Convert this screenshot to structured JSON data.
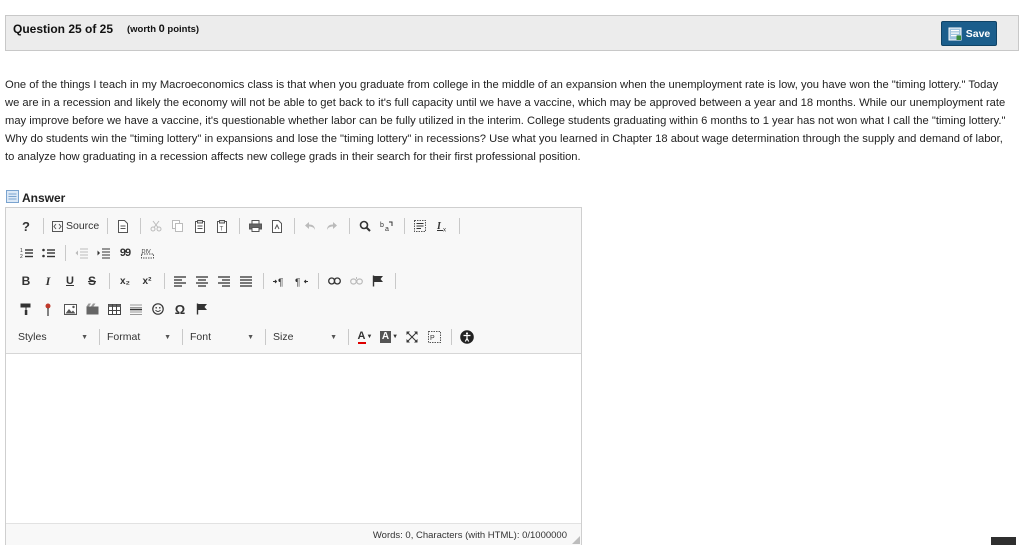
{
  "header": {
    "question_label": "Question 25 of 25",
    "worth_prefix": "(worth ",
    "worth_value": "0",
    "worth_suffix": " points)",
    "save_label": "Save"
  },
  "question": {
    "text": "One of the things I teach in my Macroeconomics class is that when you graduate from college in the middle of an expansion when the unemployment rate is low, you have won the \"timing lottery.\"  Today we are in a recession and likely the economy will not be able to get back to it's full capacity until we have a vaccine, which may be approved between a year and 18 months. While our unemployment rate may improve before we have a vaccine, it's questionable whether labor can be fully utilized in the interim.  College students graduating within 6 months to 1 year has not won what I call the \"timing lottery.\"  Why do students win the \"timing lottery\" in expansions and lose the \"timing lottery\" in recessions?  Use what you learned in Chapter 18 about wage determination through the supply and demand of labor, to analyze how graduating in a recession affects new college grads in their search for their first professional position."
  },
  "answer": {
    "label": "Answer"
  },
  "editor": {
    "toolbar": {
      "help": "?",
      "source": "Source",
      "bold": "B",
      "italic": "I",
      "underline": "U",
      "strike": "S",
      "subscript": "x₂",
      "superscript": "x²",
      "blockquote": "99",
      "omega": "Ω",
      "styles": "Styles",
      "format": "Format",
      "font": "Font",
      "size": "Size",
      "text_color": "A",
      "bg_color": "A"
    },
    "status": {
      "word_count": "Words: 0, Characters (with HTML): 0/1000000"
    }
  },
  "colors": {
    "save_button": "#1b5e8c",
    "header_bg": "#ececec",
    "toolbar_bg": "#f8f8f8"
  }
}
